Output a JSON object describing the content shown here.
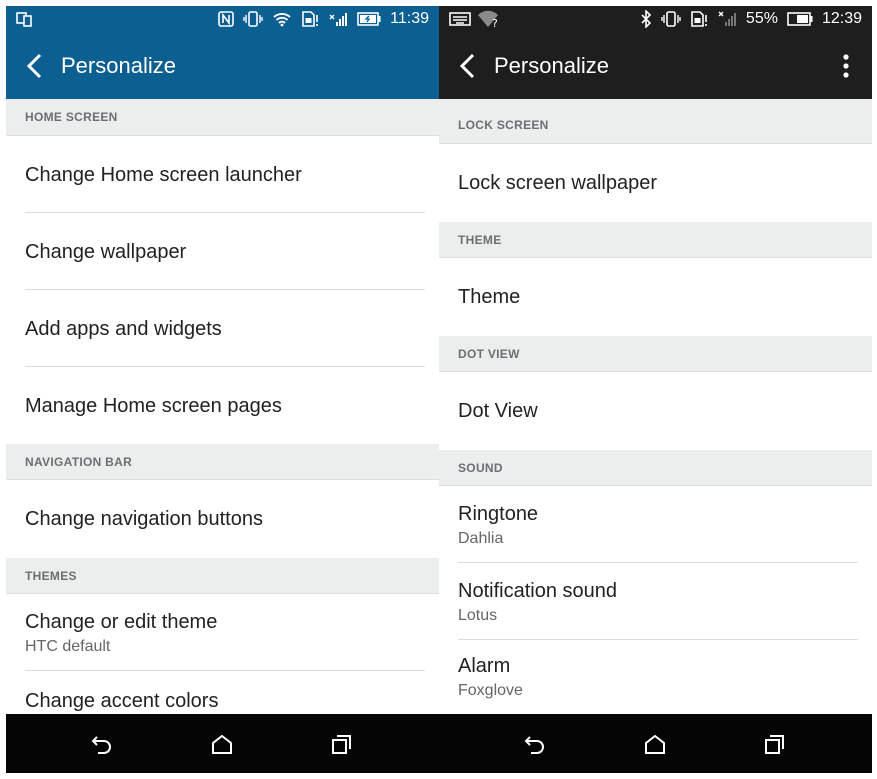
{
  "left": {
    "status_bar": {
      "time": "11:39",
      "icons": [
        "screen-mirror-icon",
        "nfc-icon",
        "vibrate-icon",
        "wifi-icon",
        "sim-alert-icon",
        "signal-icon",
        "battery-charging-icon"
      ]
    },
    "app_bar": {
      "title": "Personalize",
      "back_icon": "chevron-left-icon"
    },
    "sections": [
      {
        "header": "HOME SCREEN",
        "items": [
          {
            "title": "Change Home screen launcher"
          },
          {
            "title": "Change wallpaper"
          },
          {
            "title": "Add apps and widgets"
          },
          {
            "title": "Manage Home screen pages"
          }
        ]
      },
      {
        "header": "NAVIGATION BAR",
        "items": [
          {
            "title": "Change navigation buttons"
          }
        ]
      },
      {
        "header": "THEMES",
        "items": [
          {
            "title": "Change or edit theme",
            "subtitle": "HTC default"
          },
          {
            "title": "Change accent colors"
          }
        ]
      }
    ],
    "nav_bar": {
      "icons": [
        "back-icon",
        "home-icon",
        "recents-icon"
      ]
    }
  },
  "right": {
    "status_bar": {
      "time": "12:39",
      "battery_percent": "55%",
      "icons": [
        "keyboard-icon",
        "wifi-unknown-icon",
        "bluetooth-icon",
        "vibrate-icon",
        "sim-alert-icon",
        "no-signal-icon",
        "battery-icon"
      ]
    },
    "app_bar": {
      "title": "Personalize",
      "back_icon": "chevron-left-icon",
      "menu_icon": "overflow-menu-icon"
    },
    "sections": [
      {
        "header": "LOCK SCREEN",
        "items": [
          {
            "title": "Lock screen wallpaper"
          }
        ]
      },
      {
        "header": "THEME",
        "items": [
          {
            "title": "Theme"
          }
        ]
      },
      {
        "header": "DOT VIEW",
        "items": [
          {
            "title": "Dot View"
          }
        ]
      },
      {
        "header": "SOUND",
        "items": [
          {
            "title": "Ringtone",
            "subtitle": "Dahlia"
          },
          {
            "title": "Notification sound",
            "subtitle": "Lotus"
          },
          {
            "title": "Alarm",
            "subtitle": "Foxglove"
          }
        ]
      }
    ],
    "nav_bar": {
      "icons": [
        "back-icon",
        "home-icon",
        "recents-icon"
      ]
    }
  },
  "colors": {
    "left_accent": "#0c5f91",
    "right_accent": "#1e1e1e",
    "section_bg": "#eceeee",
    "nav_bg": "#050505"
  }
}
